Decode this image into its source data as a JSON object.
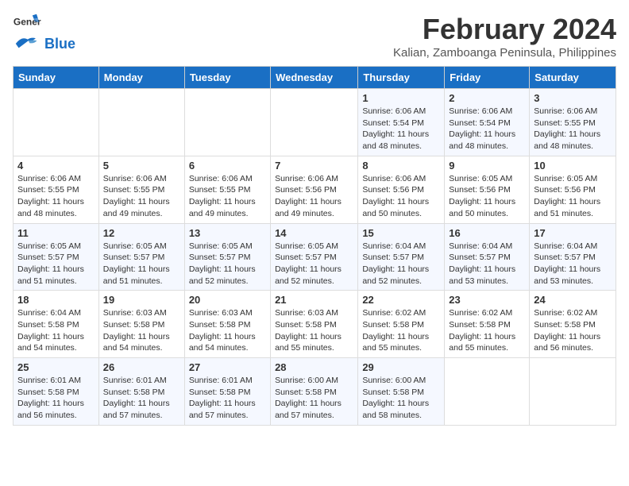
{
  "logo": {
    "line1": "General",
    "line2": "Blue"
  },
  "title": "February 2024",
  "subtitle": "Kalian, Zamboanga Peninsula, Philippines",
  "headers": [
    "Sunday",
    "Monday",
    "Tuesday",
    "Wednesday",
    "Thursday",
    "Friday",
    "Saturday"
  ],
  "weeks": [
    [
      {
        "day": "",
        "info": ""
      },
      {
        "day": "",
        "info": ""
      },
      {
        "day": "",
        "info": ""
      },
      {
        "day": "",
        "info": ""
      },
      {
        "day": "1",
        "info": "Sunrise: 6:06 AM\nSunset: 5:54 PM\nDaylight: 11 hours and 48 minutes."
      },
      {
        "day": "2",
        "info": "Sunrise: 6:06 AM\nSunset: 5:54 PM\nDaylight: 11 hours and 48 minutes."
      },
      {
        "day": "3",
        "info": "Sunrise: 6:06 AM\nSunset: 5:55 PM\nDaylight: 11 hours and 48 minutes."
      }
    ],
    [
      {
        "day": "4",
        "info": "Sunrise: 6:06 AM\nSunset: 5:55 PM\nDaylight: 11 hours and 48 minutes."
      },
      {
        "day": "5",
        "info": "Sunrise: 6:06 AM\nSunset: 5:55 PM\nDaylight: 11 hours and 49 minutes."
      },
      {
        "day": "6",
        "info": "Sunrise: 6:06 AM\nSunset: 5:55 PM\nDaylight: 11 hours and 49 minutes."
      },
      {
        "day": "7",
        "info": "Sunrise: 6:06 AM\nSunset: 5:56 PM\nDaylight: 11 hours and 49 minutes."
      },
      {
        "day": "8",
        "info": "Sunrise: 6:06 AM\nSunset: 5:56 PM\nDaylight: 11 hours and 50 minutes."
      },
      {
        "day": "9",
        "info": "Sunrise: 6:05 AM\nSunset: 5:56 PM\nDaylight: 11 hours and 50 minutes."
      },
      {
        "day": "10",
        "info": "Sunrise: 6:05 AM\nSunset: 5:56 PM\nDaylight: 11 hours and 51 minutes."
      }
    ],
    [
      {
        "day": "11",
        "info": "Sunrise: 6:05 AM\nSunset: 5:57 PM\nDaylight: 11 hours and 51 minutes."
      },
      {
        "day": "12",
        "info": "Sunrise: 6:05 AM\nSunset: 5:57 PM\nDaylight: 11 hours and 51 minutes."
      },
      {
        "day": "13",
        "info": "Sunrise: 6:05 AM\nSunset: 5:57 PM\nDaylight: 11 hours and 52 minutes."
      },
      {
        "day": "14",
        "info": "Sunrise: 6:05 AM\nSunset: 5:57 PM\nDaylight: 11 hours and 52 minutes."
      },
      {
        "day": "15",
        "info": "Sunrise: 6:04 AM\nSunset: 5:57 PM\nDaylight: 11 hours and 52 minutes."
      },
      {
        "day": "16",
        "info": "Sunrise: 6:04 AM\nSunset: 5:57 PM\nDaylight: 11 hours and 53 minutes."
      },
      {
        "day": "17",
        "info": "Sunrise: 6:04 AM\nSunset: 5:57 PM\nDaylight: 11 hours and 53 minutes."
      }
    ],
    [
      {
        "day": "18",
        "info": "Sunrise: 6:04 AM\nSunset: 5:58 PM\nDaylight: 11 hours and 54 minutes."
      },
      {
        "day": "19",
        "info": "Sunrise: 6:03 AM\nSunset: 5:58 PM\nDaylight: 11 hours and 54 minutes."
      },
      {
        "day": "20",
        "info": "Sunrise: 6:03 AM\nSunset: 5:58 PM\nDaylight: 11 hours and 54 minutes."
      },
      {
        "day": "21",
        "info": "Sunrise: 6:03 AM\nSunset: 5:58 PM\nDaylight: 11 hours and 55 minutes."
      },
      {
        "day": "22",
        "info": "Sunrise: 6:02 AM\nSunset: 5:58 PM\nDaylight: 11 hours and 55 minutes."
      },
      {
        "day": "23",
        "info": "Sunrise: 6:02 AM\nSunset: 5:58 PM\nDaylight: 11 hours and 55 minutes."
      },
      {
        "day": "24",
        "info": "Sunrise: 6:02 AM\nSunset: 5:58 PM\nDaylight: 11 hours and 56 minutes."
      }
    ],
    [
      {
        "day": "25",
        "info": "Sunrise: 6:01 AM\nSunset: 5:58 PM\nDaylight: 11 hours and 56 minutes."
      },
      {
        "day": "26",
        "info": "Sunrise: 6:01 AM\nSunset: 5:58 PM\nDaylight: 11 hours and 57 minutes."
      },
      {
        "day": "27",
        "info": "Sunrise: 6:01 AM\nSunset: 5:58 PM\nDaylight: 11 hours and 57 minutes."
      },
      {
        "day": "28",
        "info": "Sunrise: 6:00 AM\nSunset: 5:58 PM\nDaylight: 11 hours and 57 minutes."
      },
      {
        "day": "29",
        "info": "Sunrise: 6:00 AM\nSunset: 5:58 PM\nDaylight: 11 hours and 58 minutes."
      },
      {
        "day": "",
        "info": ""
      },
      {
        "day": "",
        "info": ""
      }
    ]
  ]
}
